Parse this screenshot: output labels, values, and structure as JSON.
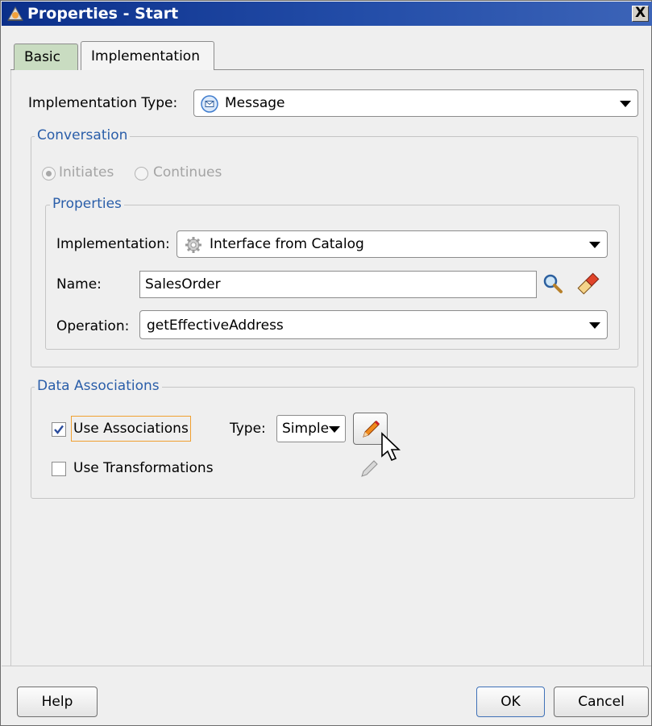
{
  "window": {
    "title": "Properties - Start",
    "close_label": "X"
  },
  "tabs": [
    {
      "label": "Basic"
    },
    {
      "label": "Implementation"
    }
  ],
  "implementation_type": {
    "label": "Implementation Type:",
    "value": "Message"
  },
  "conversation": {
    "legend": "Conversation",
    "initiates_label": "Initiates",
    "continues_label": "Continues",
    "properties": {
      "legend": "Properties",
      "implementation_label": "Implementation:",
      "implementation_value": "Interface from Catalog",
      "name_label": "Name:",
      "name_value": "SalesOrder",
      "operation_label": "Operation:",
      "operation_value": "getEffectiveAddress"
    }
  },
  "data_associations": {
    "legend": "Data Associations",
    "use_associations_label": "Use Associations",
    "use_associations_checked": true,
    "type_label": "Type:",
    "type_value": "Simple",
    "use_transformations_label": "Use Transformations",
    "use_transformations_checked": false
  },
  "footer": {
    "help_label": "Help",
    "ok_label": "OK",
    "cancel_label": "Cancel"
  },
  "icons": [
    "application-icon",
    "message-icon",
    "gear-icon",
    "search-icon",
    "eraser-icon",
    "pencil-icon",
    "mouse-cursor-icon"
  ],
  "colors": {
    "title_bar": "#0b2f8a",
    "legend_text": "#2a5ea9",
    "focus_outline": "#f0a030",
    "basic_tab": "#c9dcc1"
  }
}
